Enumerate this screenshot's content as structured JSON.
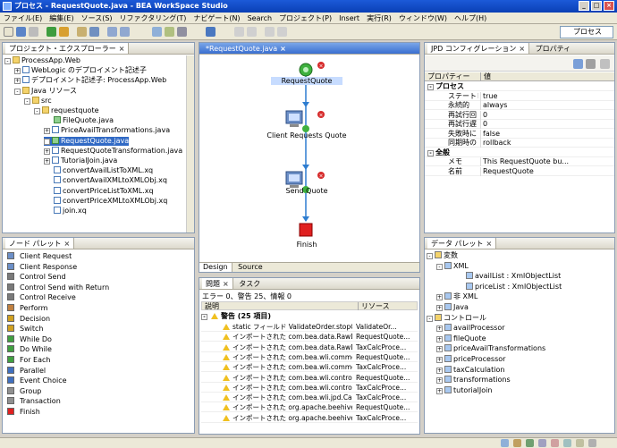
{
  "window": {
    "title": "プロセス - RequestQuote.java - BEA WorkSpace Studio"
  },
  "menu": [
    "ファイル(E)",
    "編集(E)",
    "ソース(S)",
    "リファクタリング(T)",
    "ナビゲート(N)",
    "Search",
    "プロジェクト(P)",
    "Insert",
    "実行(R)",
    "ウィンドウ(W)",
    "ヘルプ(H)"
  ],
  "perspective": {
    "label": "プロセス"
  },
  "project_explorer": {
    "title": "プロジェクト・エクスプローラー",
    "items": [
      {
        "label": "ProcessApp.Web",
        "indent": 0,
        "icon": "folder",
        "expand": "-"
      },
      {
        "label": "WebLogic のデプロイメント記述子",
        "indent": 1,
        "icon": "file",
        "expand": "+"
      },
      {
        "label": "デプロイメント記述子: ProcessApp.Web",
        "indent": 1,
        "icon": "file",
        "expand": "+"
      },
      {
        "label": "Java リソース",
        "indent": 1,
        "icon": "folder",
        "expand": "-"
      },
      {
        "label": "src",
        "indent": 2,
        "icon": "folder",
        "expand": "-"
      },
      {
        "label": "requestquote",
        "indent": 3,
        "icon": "folder",
        "expand": "-"
      },
      {
        "label": "FileQuote.java",
        "indent": 4,
        "icon": "proc",
        "expand": ""
      },
      {
        "label": "PriceAvailTransformations.java",
        "indent": 4,
        "icon": "file",
        "expand": "+"
      },
      {
        "label": "RequestQuote.java",
        "indent": 4,
        "icon": "proc",
        "expand": "+",
        "selected": true
      },
      {
        "label": "RequestQuoteTransformation.java",
        "indent": 4,
        "icon": "file",
        "expand": "+"
      },
      {
        "label": "TutorialJoin.java",
        "indent": 4,
        "icon": "file",
        "expand": "+"
      },
      {
        "label": "convertAvailListToXML.xq",
        "indent": 4,
        "icon": "file",
        "expand": ""
      },
      {
        "label": "convertAvailXMLtoXMLObj.xq",
        "indent": 4,
        "icon": "file",
        "expand": ""
      },
      {
        "label": "convertPriceListToXML.xq",
        "indent": 4,
        "icon": "file",
        "expand": ""
      },
      {
        "label": "convertPriceXMLtoXMLObj.xq",
        "indent": 4,
        "icon": "file",
        "expand": ""
      },
      {
        "label": "join.xq",
        "indent": 4,
        "icon": "file",
        "expand": ""
      }
    ]
  },
  "node_palette": {
    "title": "ノード パレット",
    "items": [
      "Client Request",
      "Client Response",
      "Control Send",
      "Control Send with Return",
      "Control Receive",
      "Perform",
      "Decision",
      "Switch",
      "While Do",
      "Do While",
      "For Each",
      "Parallel",
      "Event Choice",
      "Group",
      "Transaction",
      "Finish"
    ]
  },
  "editor": {
    "tab": "*RequestQuote.java",
    "nodes": [
      "RequestQuote",
      "Client Requests Quote",
      "Send Quote",
      "Finish"
    ],
    "bottom_tabs": [
      "Design",
      "Source"
    ]
  },
  "properties": {
    "tabs": [
      "JPD コンフィグレーション",
      "プロパティ"
    ],
    "col_property": "プロパティー",
    "col_value": "値",
    "sections": [
      {
        "name": "プロセス",
        "rows": [
          [
            "ステートレス",
            "true"
          ],
          [
            "永続的",
            "always"
          ],
          [
            "再試行回",
            "0"
          ],
          [
            "再試行遅",
            "0"
          ],
          [
            "失敗時に",
            "false"
          ],
          [
            "同期時の",
            "rollback"
          ]
        ]
      },
      {
        "name": "全般",
        "rows": [
          [
            "メモ",
            "This RequestQuote bu..."
          ],
          [
            "名前",
            "RequestQuote"
          ]
        ]
      }
    ]
  },
  "problems": {
    "tabs": [
      "問題",
      "タスク"
    ],
    "summary": "エラー 0、警告 25、情報 0",
    "col_desc": "説明",
    "col_resource": "リソース",
    "group": "警告 (25 項目)",
    "rows": [
      [
        "static フィールド ValidateOrder.stopQuote には static にアクセスする必要があります。",
        "ValidateOr..."
      ],
      [
        "インポートされた com.bea.data.RawData は使用されません",
        "RequestQuote..."
      ],
      [
        "インポートされた com.bea.data.RawData は使用されません",
        "TaxCalcProce..."
      ],
      [
        "インポートされた com.bea.wli.common は使用されません",
        "RequestQuote..."
      ],
      [
        "インポートされた com.bea.wli.common は使用されません",
        "TaxCalcProce..."
      ],
      [
        "インポートされた com.bea.wli.control.broke は使用されません",
        "RequestQuote..."
      ],
      [
        "インポートされた com.bea.wli.control.broke は使用されません",
        "TaxCalcProce..."
      ],
      [
        "インポートされた com.bea.wli.jpd.Callback は使用されません",
        "TaxCalcProce..."
      ],
      [
        "インポートされた org.apache.beehive.contr は使用されません",
        "RequestQuote..."
      ],
      [
        "インポートされた org.apache.beehive.contr は使用されません",
        "TaxCalcProce..."
      ]
    ]
  },
  "data_palette": {
    "title": "データ パレット",
    "items": [
      {
        "label": "変数",
        "indent": 0,
        "expand": "-"
      },
      {
        "label": "XML",
        "indent": 1,
        "expand": "-"
      },
      {
        "label": "availList : XmlObjectList",
        "indent": 3,
        "expand": ""
      },
      {
        "label": "priceList : XmlObjectList",
        "indent": 3,
        "expand": ""
      },
      {
        "label": "非 XML",
        "indent": 1,
        "expand": "+"
      },
      {
        "label": "Java",
        "indent": 1,
        "expand": "+"
      },
      {
        "label": "コントロール",
        "indent": 0,
        "expand": "-"
      },
      {
        "label": "availProcessor",
        "indent": 1,
        "expand": "+"
      },
      {
        "label": "fileQuote",
        "indent": 1,
        "expand": "+"
      },
      {
        "label": "priceAvailTransformations",
        "indent": 1,
        "expand": "+"
      },
      {
        "label": "priceProcessor",
        "indent": 1,
        "expand": "+"
      },
      {
        "label": "taxCalculation",
        "indent": 1,
        "expand": "+"
      },
      {
        "label": "transformations",
        "indent": 1,
        "expand": "+"
      },
      {
        "label": "tutorialJoin",
        "indent": 1,
        "expand": "+"
      }
    ]
  }
}
